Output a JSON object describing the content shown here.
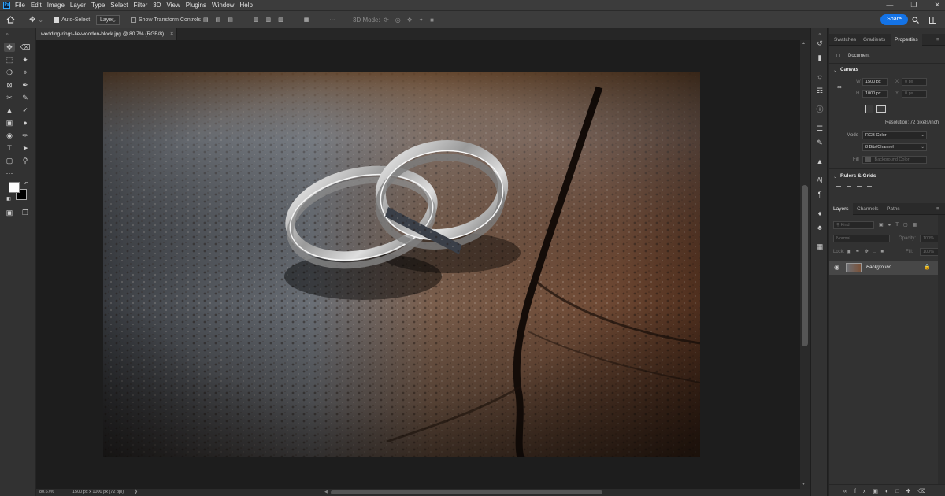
{
  "menubar": {
    "items": [
      "File",
      "Edit",
      "Image",
      "Layer",
      "Type",
      "Select",
      "Filter",
      "3D",
      "View",
      "Plugins",
      "Window",
      "Help"
    ]
  },
  "options_bar": {
    "auto_select_label": "Auto-Select",
    "layer_select_value": "Layer",
    "show_transform_label": "Show Transform Controls",
    "mode_3d_label": "3D Mode:",
    "share_label": "Share"
  },
  "document": {
    "tab_title": "wedding-rings-lie-wooden-block.jpg @ 80.7% (RGB/8)",
    "zoom": "80.67%",
    "dimensions_info": "1500 px x 1000 px (72 ppi)"
  },
  "properties": {
    "tabs": [
      "Swatches",
      "Gradients",
      "Properties"
    ],
    "doc_label": "Document",
    "canvas_section": "Canvas",
    "w_label": "W",
    "w_value": "1500 px",
    "h_label": "H",
    "h_value": "1000 px",
    "x_label": "X",
    "x_value": "0 px",
    "y_label": "Y",
    "y_value": "0 px",
    "resolution": "Resolution: 72 pixels/inch",
    "mode_label": "Mode",
    "mode_value": "RGB Color",
    "bits_value": "8 Bits/Channel",
    "fill_label": "Fill",
    "fill_value": "Background Color",
    "rulers_section": "Rulers & Grids"
  },
  "layers": {
    "tabs": [
      "Layers",
      "Channels",
      "Paths"
    ],
    "kind_placeholder": "Kind",
    "blend_mode": "Normal",
    "opacity_label": "Opacity:",
    "opacity_value": "100%",
    "lock_label": "Lock:",
    "fill_label": "Fill:",
    "fill_value": "100%",
    "layer_name": "Background"
  },
  "colors": {
    "accent": "#1473e6",
    "foreground": "#ffffff",
    "background": "#000000"
  }
}
